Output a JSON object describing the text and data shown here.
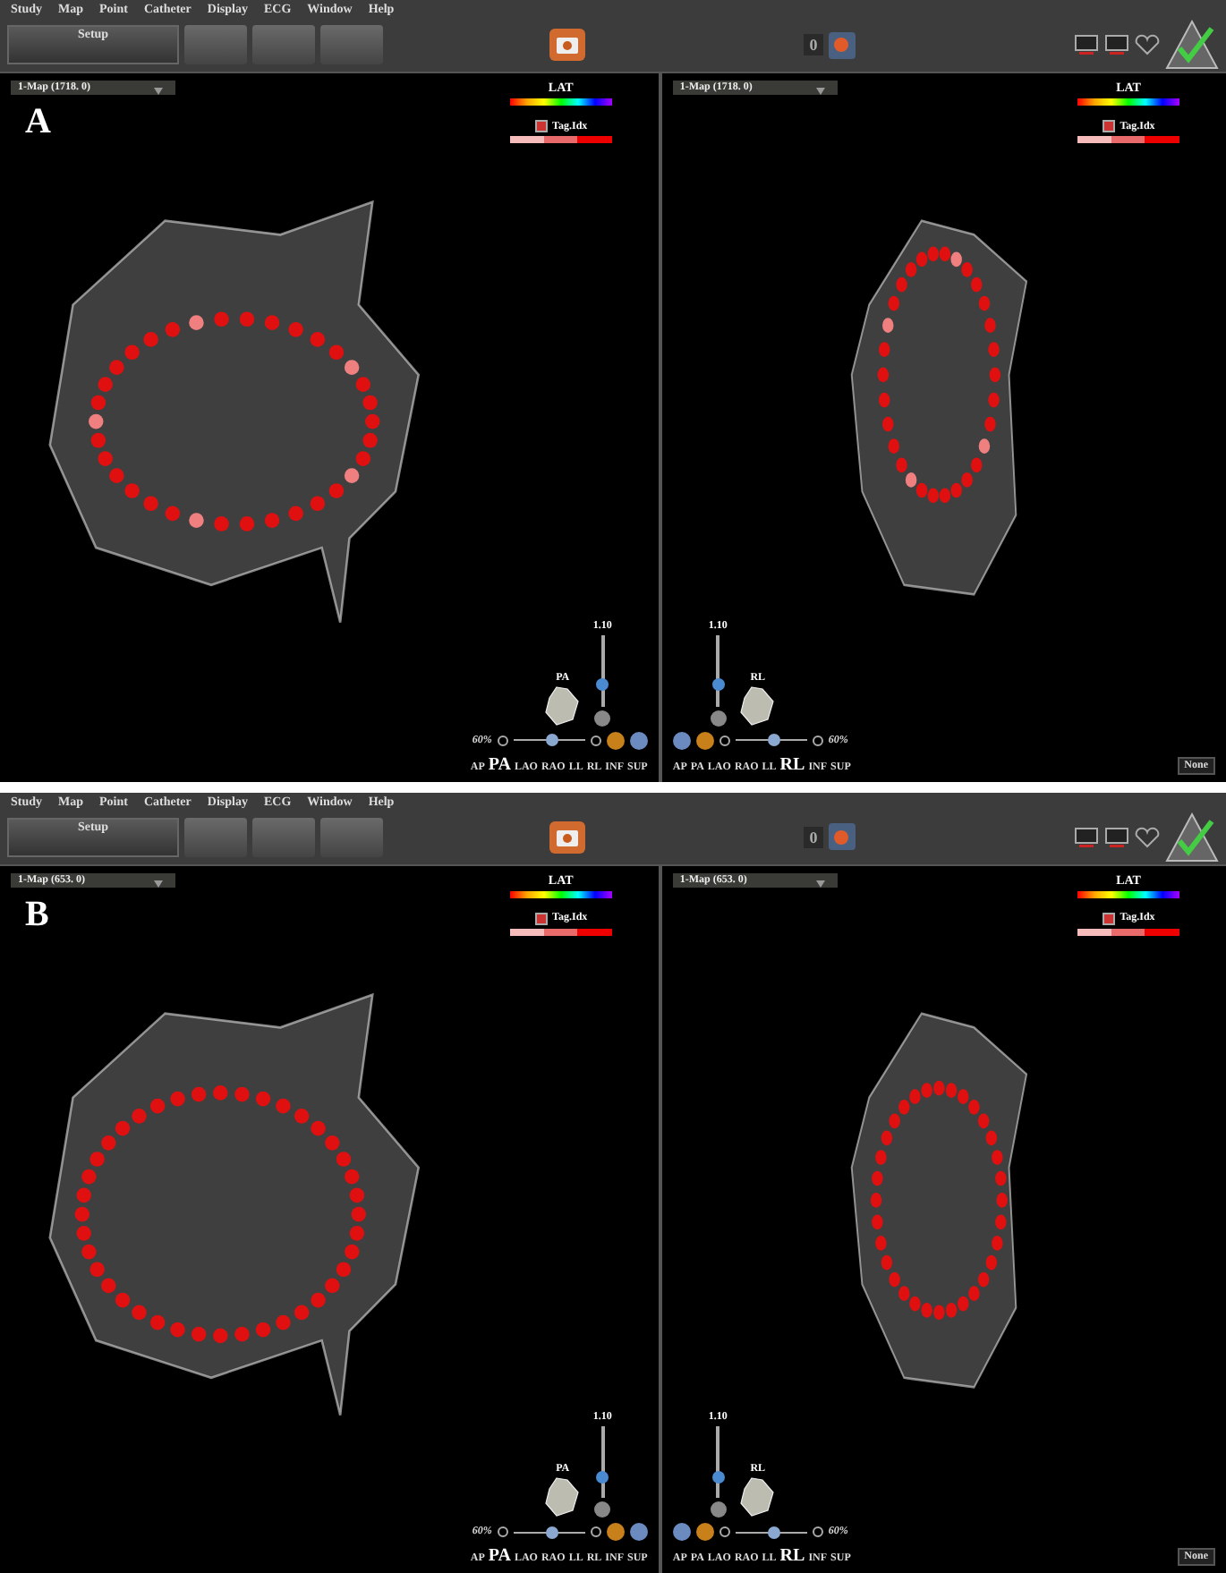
{
  "panels": [
    {
      "label": "A",
      "menu": [
        "Study",
        "Map",
        "Point",
        "Catheter",
        "Display",
        "ECG",
        "Window",
        "Help"
      ],
      "setup": "Setup",
      "counter": "0",
      "views": [
        {
          "map": "1-Map (1718. 0)",
          "legend": "LAT",
          "tag": "Tag.Idx",
          "tag_checked": true,
          "zoom": {
            "reading": "1.10",
            "level": 0.3
          },
          "view_title": "PA",
          "opacity": {
            "reading": "60%",
            "level": 0.55
          },
          "orientations": [
            {
              "label": "AP",
              "selected": false
            },
            {
              "label": "PA",
              "selected": true
            },
            {
              "label": "LAO",
              "selected": false
            },
            {
              "label": "RAO",
              "selected": false
            },
            {
              "label": "LL",
              "selected": false
            },
            {
              "label": "RL",
              "selected": false
            },
            {
              "label": "INF",
              "selected": false
            },
            {
              "label": "SUP",
              "selected": false
            }
          ]
        },
        {
          "map": "1-Map (1718. 0)",
          "legend": "LAT",
          "tag": "Tag.Idx",
          "tag_checked": true,
          "zoom": {
            "reading": "1.10",
            "level": 0.3
          },
          "view_title": "RL",
          "opacity": {
            "reading": "60%",
            "level": 0.55
          },
          "orientations": [
            {
              "label": "AP",
              "selected": false
            },
            {
              "label": "PA",
              "selected": false
            },
            {
              "label": "LAO",
              "selected": false
            },
            {
              "label": "RAO",
              "selected": false
            },
            {
              "label": "LL",
              "selected": false
            },
            {
              "label": "RL",
              "selected": true
            },
            {
              "label": "INF",
              "selected": false
            },
            {
              "label": "SUP",
              "selected": false
            }
          ],
          "dropdown": "None"
        }
      ]
    },
    {
      "label": "B",
      "menu": [
        "Study",
        "Map",
        "Point",
        "Catheter",
        "Display",
        "ECG",
        "Window",
        "Help"
      ],
      "setup": "Setup",
      "counter": "0",
      "views": [
        {
          "map": "1-Map (653. 0)",
          "legend": "LAT",
          "tag": "Tag.Idx",
          "tag_checked": true,
          "zoom": {
            "reading": "1.10",
            "level": 0.3
          },
          "view_title": "PA",
          "opacity": {
            "reading": "60%",
            "level": 0.55
          },
          "orientations": [
            {
              "label": "AP",
              "selected": false
            },
            {
              "label": "PA",
              "selected": true
            },
            {
              "label": "LAO",
              "selected": false
            },
            {
              "label": "RAO",
              "selected": false
            },
            {
              "label": "LL",
              "selected": false
            },
            {
              "label": "RL",
              "selected": false
            },
            {
              "label": "INF",
              "selected": false
            },
            {
              "label": "SUP",
              "selected": false
            }
          ]
        },
        {
          "map": "1-Map (653. 0)",
          "legend": "LAT",
          "tag": "Tag.Idx",
          "tag_checked": true,
          "zoom": {
            "reading": "1.10",
            "level": 0.3
          },
          "view_title": "RL",
          "opacity": {
            "reading": "60%",
            "level": 0.55
          },
          "orientations": [
            {
              "label": "AP",
              "selected": false
            },
            {
              "label": "PA",
              "selected": false
            },
            {
              "label": "LAO",
              "selected": false
            },
            {
              "label": "RAO",
              "selected": false
            },
            {
              "label": "LL",
              "selected": false
            },
            {
              "label": "RL",
              "selected": true
            },
            {
              "label": "INF",
              "selected": false
            },
            {
              "label": "SUP",
              "selected": false
            }
          ],
          "dropdown": "None"
        }
      ]
    }
  ]
}
